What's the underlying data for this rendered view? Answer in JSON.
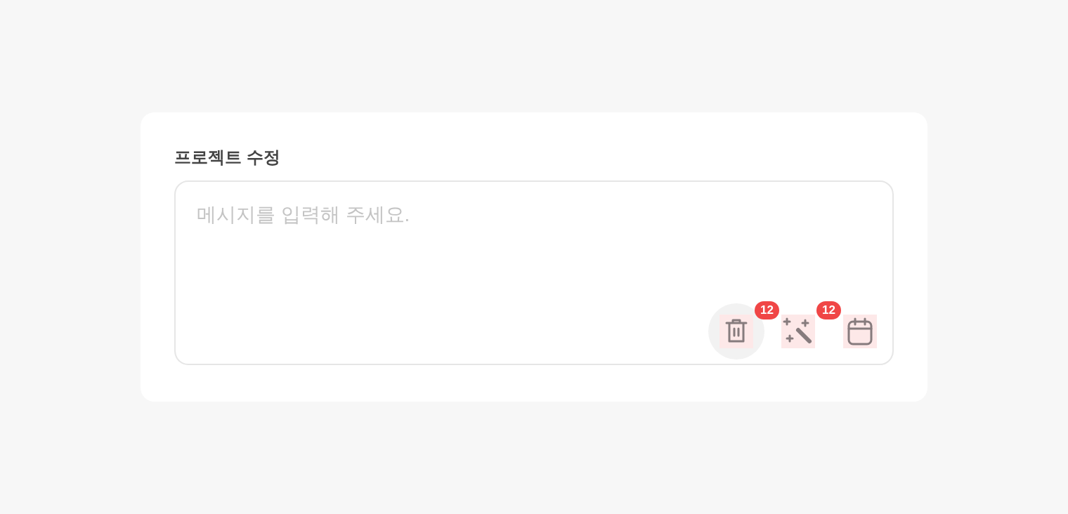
{
  "title": "프로젝트 수정",
  "message": {
    "placeholder": "메시지를 입력해 주세요."
  },
  "tools": [
    {
      "kind": "trash",
      "hovered": true
    },
    {
      "kind": "wand",
      "hovered": false,
      "badge": "12"
    },
    {
      "kind": "calendar",
      "hovered": false,
      "badge": "12"
    }
  ]
}
